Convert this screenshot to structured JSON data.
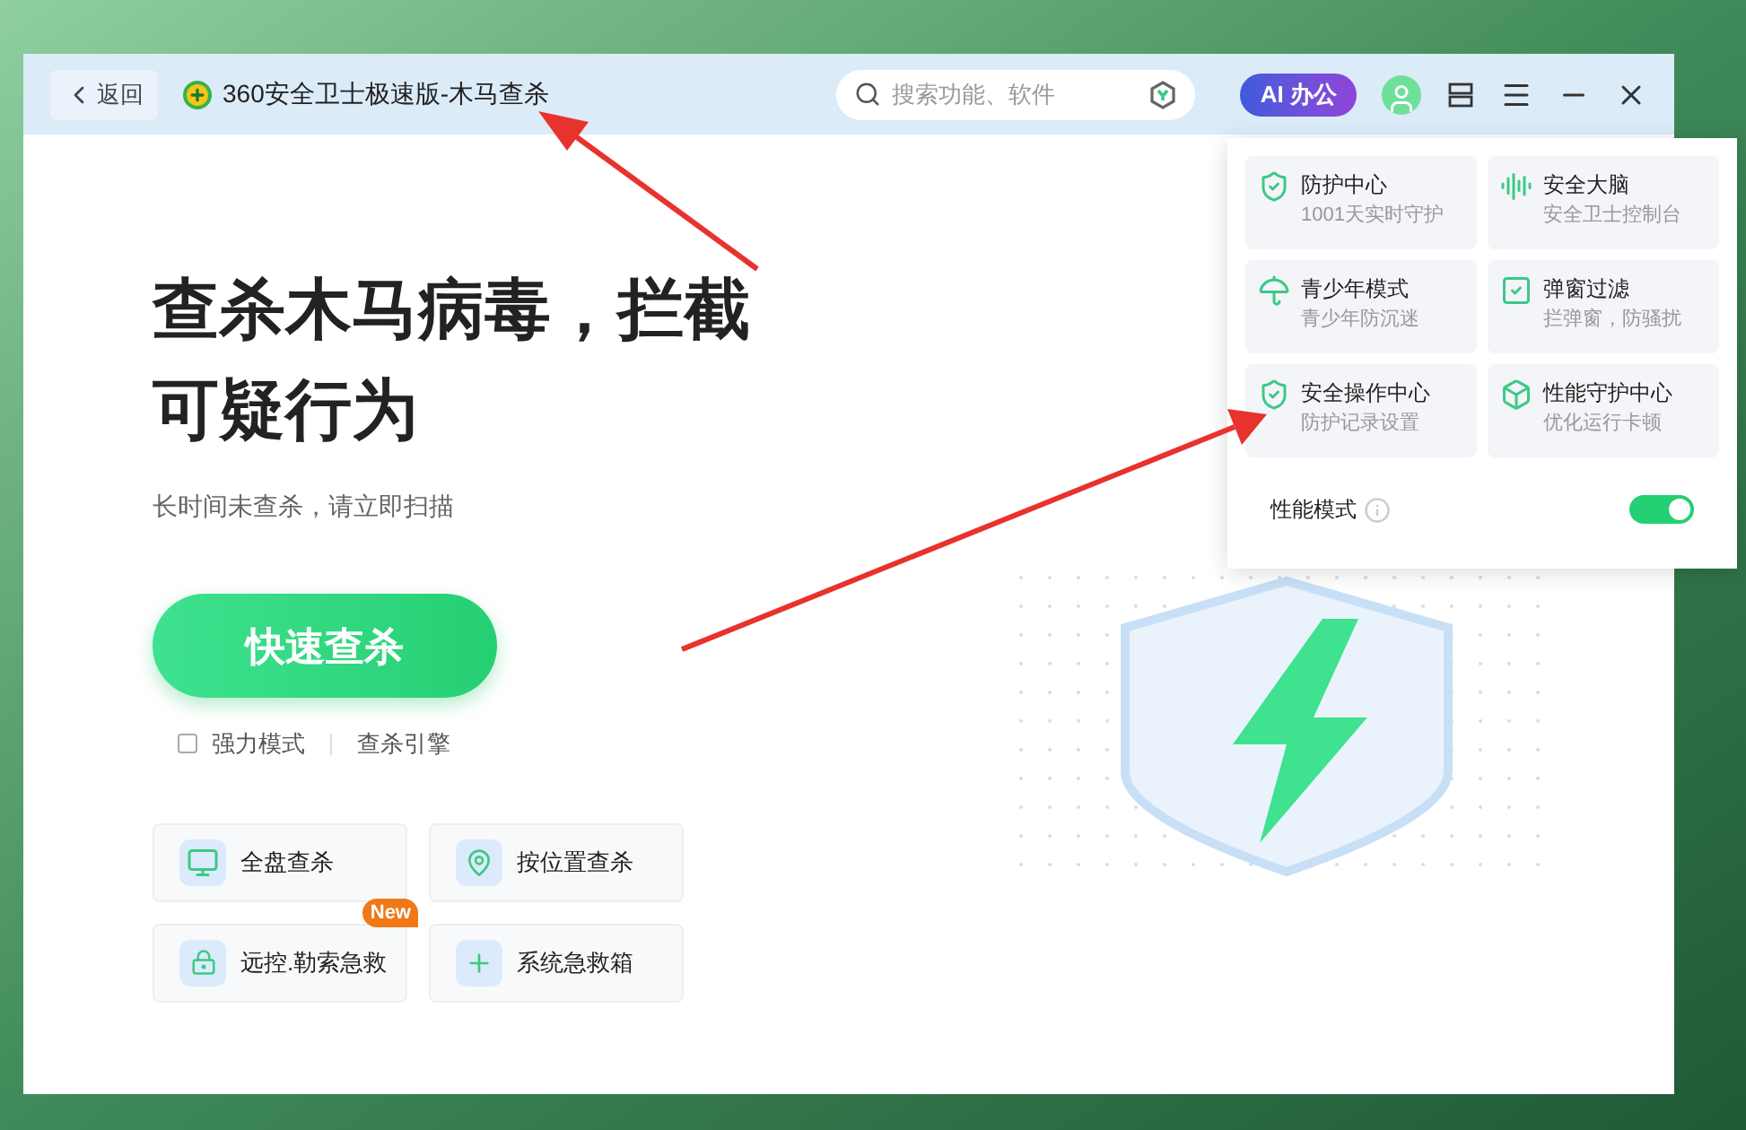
{
  "window": {
    "back_button": "返回",
    "title": "360安全卫士极速版-木马查杀",
    "search": {
      "placeholder": "搜索功能、软件"
    },
    "ai_button": "AI 办公"
  },
  "hero": {
    "headline": "查杀木马病毒，拦截可疑行为",
    "subtitle": "长时间未查杀，请立即扫描",
    "scan_button": "快速查杀",
    "strong_mode": {
      "label": "强力模式",
      "checked": false
    },
    "engine_link": "查杀引擎"
  },
  "tools": [
    {
      "label": "全盘查杀",
      "kind": "monitor"
    },
    {
      "label": "按位置查杀",
      "kind": "pin"
    },
    {
      "label": "远控.勒索急救",
      "kind": "shield",
      "badge": "New"
    },
    {
      "label": "系统急救箱",
      "kind": "kit"
    }
  ],
  "menu": {
    "items": [
      {
        "title": "防护中心",
        "subtitle": "1001天实时守护",
        "kind": "shield-check"
      },
      {
        "title": "安全大脑",
        "subtitle": "安全卫士控制台",
        "kind": "waves"
      },
      {
        "title": "青少年模式",
        "subtitle": "青少年防沉迷",
        "kind": "umbrella"
      },
      {
        "title": "弹窗过滤",
        "subtitle": "拦弹窗，防骚扰",
        "kind": "window"
      },
      {
        "title": "安全操作中心",
        "subtitle": "防护记录设置",
        "kind": "shield-bars"
      },
      {
        "title": "性能守护中心",
        "subtitle": "优化运行卡顿",
        "kind": "cube"
      }
    ],
    "performance_mode": {
      "label": "性能模式",
      "on": true
    }
  }
}
